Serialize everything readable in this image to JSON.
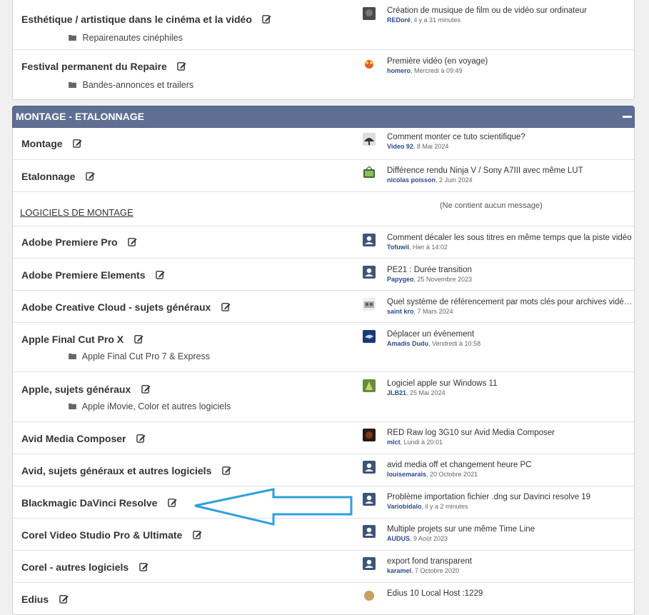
{
  "group1": {
    "rows": [
      {
        "title": "Esthétique / artistique dans le cinéma et la vidéo",
        "sub": "Repairenautes cinéphiles",
        "last_topic": "Création de musique de film ou de vidéo sur ordinateur",
        "author": "REDoré",
        "when": ", il y a 31 minutes"
      },
      {
        "title": "Festival permanent du Repaire",
        "sub": "Bandes-annonces et trailers",
        "last_topic": "Première vidéo (en voyage)",
        "author": "homero",
        "when": ", Mercredi à 09:49"
      }
    ]
  },
  "section": {
    "title": "MONTAGE - ETALONNAGE"
  },
  "group2": {
    "rows": [
      {
        "title": "Montage",
        "last_topic": "Comment monter ce tuto scientifique?",
        "author": "Video 92",
        "when": ", 8 Mai 2024"
      },
      {
        "title": "Etalonnage",
        "last_topic": "Différence rendu Ninja V / Sony A7III avec même LUT",
        "author": "nicolas poisson",
        "when": ", 2 Juin 2024"
      }
    ],
    "category": "LOGICIELS DE MONTAGE",
    "category_empty": "(Ne contient aucun message)",
    "software": [
      {
        "title": "Adobe Premiere Pro",
        "last_topic": "Comment décaler les sous titres en même temps que la piste vidéo",
        "author": "Tofuwil",
        "when": ", Hier à 14:02"
      },
      {
        "title": "Adobe Premiere Elements",
        "last_topic": "PE21 : Durée transition",
        "author": "Papygeo",
        "when": ", 25 Novembre 2023"
      },
      {
        "title": "Adobe Creative Cloud - sujets généraux",
        "last_topic": "Quel système de référencement par mots clés pour archives vidé…",
        "author": "saint kro",
        "when": ", 7 Mars 2024"
      },
      {
        "title": "Apple Final Cut Pro X",
        "sub": "Apple Final Cut Pro 7 & Express",
        "last_topic": "Déplacer un évènement",
        "author": "Amadis Dudu",
        "when": ", Vendredi à 10:58"
      },
      {
        "title": "Apple, sujets généraux",
        "sub": "Apple iMovie, Color et autres logiciels",
        "last_topic": "Logiciel apple sur Windows 11",
        "author": "JLB21",
        "when": ", 25 Mai 2024"
      },
      {
        "title": "Avid Media Composer",
        "last_topic": "RED Raw log 3G10 sur Avid Media Composer",
        "author": "mlct",
        "when": ", Lundi à 20:01"
      },
      {
        "title": "Avid, sujets généraux et autres logiciels",
        "last_topic": "avid media off et changement heure PC",
        "author": "louisemarais",
        "when": ", 20 Octobre 2021"
      },
      {
        "title": "Blackmagic DaVinci Resolve",
        "last_topic": "Problème importation fichier .dng sur Davinci resolve 19",
        "author": "Variobidalo",
        "when": ", il y a 2 minutes"
      },
      {
        "title": "Corel Video Studio Pro & Ultimate",
        "last_topic": "Multiple projets sur une même Time Line",
        "author": "AUDUS",
        "when": ", 9 Août 2023"
      },
      {
        "title": "Corel - autres logiciels",
        "last_topic": "export fond transparent",
        "author": "karamel",
        "when": ", 7 Octobre 2020"
      },
      {
        "title": "Edius",
        "last_topic": "Edius 10 Local Host :1229",
        "author": "",
        "when": ""
      }
    ]
  },
  "colors": {
    "header_bg": "#5f6f93",
    "annotation_arrow": "#2ea0dd",
    "author_link": "#2a4c8c"
  },
  "icons": [
    "edit-icon",
    "folder-icon",
    "user-avatar-icon",
    "collapse-icon"
  ]
}
